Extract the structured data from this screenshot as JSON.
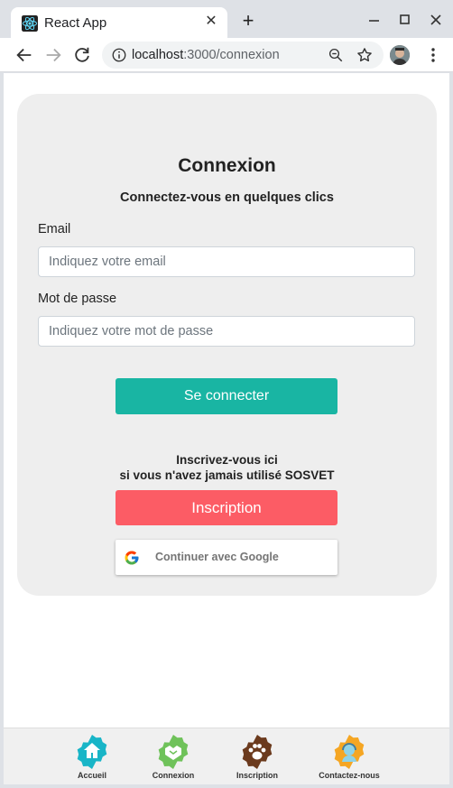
{
  "browser": {
    "tab_title": "React App",
    "url_host": "localhost",
    "url_path": ":3000/connexion"
  },
  "form": {
    "title": "Connexion",
    "subtitle": "Connectez-vous en quelques clics",
    "email_label": "Email",
    "email_placeholder": "Indiquez votre email",
    "email_value": "",
    "password_label": "Mot de passe",
    "password_placeholder": "Indiquez votre mot de passe",
    "password_value": "",
    "login_button": "Se connecter",
    "signup_line1": "Inscrivez-vous ici",
    "signup_line2": "si vous n'avez jamais utilisé SOSVET",
    "signup_button": "Inscription",
    "google_button": "Continuer avec Google"
  },
  "bottom_nav": {
    "items": [
      {
        "label": "Accueil",
        "icon": "home-icon",
        "color": "#19b5c7"
      },
      {
        "label": "Connexion",
        "icon": "handshake-icon",
        "color": "#6fc25a"
      },
      {
        "label": "Inscription",
        "icon": "paw-icon",
        "color": "#6b3a1d"
      },
      {
        "label": "Contactez-nous",
        "icon": "support-agent-icon",
        "color": "#f5a623"
      }
    ]
  },
  "colors": {
    "login_button": "#19b5a3",
    "signup_button": "#fc5c65",
    "card_background": "#eeeeee"
  }
}
